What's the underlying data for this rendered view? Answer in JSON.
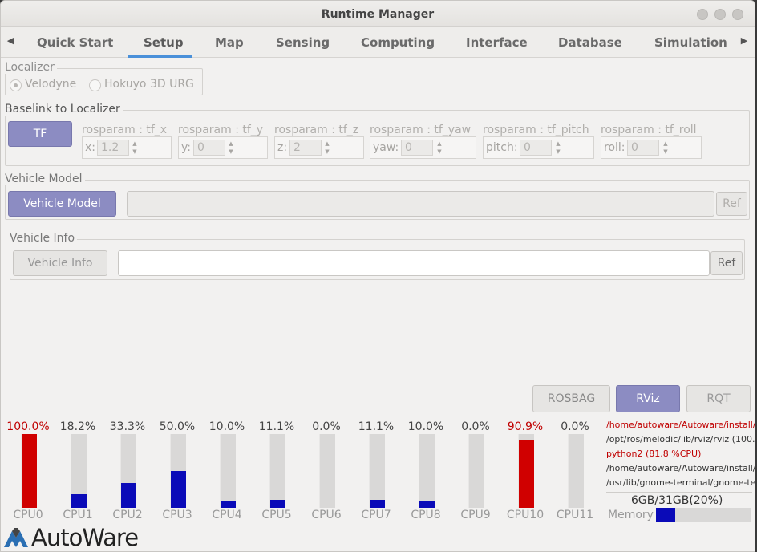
{
  "window": {
    "title": "Runtime Manager"
  },
  "tabs": [
    {
      "label": "Quick Start"
    },
    {
      "label": "Setup"
    },
    {
      "label": "Map"
    },
    {
      "label": "Sensing"
    },
    {
      "label": "Computing"
    },
    {
      "label": "Interface"
    },
    {
      "label": "Database"
    },
    {
      "label": "Simulation"
    }
  ],
  "localizer": {
    "label": "Localizer",
    "options": [
      {
        "label": "Velodyne",
        "checked": true
      },
      {
        "label": "Hokuyo 3D URG",
        "checked": false
      }
    ]
  },
  "baselink": {
    "label": "Baselink to Localizer",
    "tf_button": "TF",
    "params": [
      {
        "label": "rosparam : tf_x",
        "prefix": "x:",
        "value": "1.2"
      },
      {
        "label": "rosparam : tf_y",
        "prefix": "y:",
        "value": "0"
      },
      {
        "label": "rosparam : tf_z",
        "prefix": "z:",
        "value": "2"
      },
      {
        "label": "rosparam : tf_yaw",
        "prefix": "yaw:",
        "value": "0"
      },
      {
        "label": "rosparam : tf_pitch",
        "prefix": "pitch:",
        "value": "0"
      },
      {
        "label": "rosparam : tf_roll",
        "prefix": "roll:",
        "value": "0"
      }
    ]
  },
  "vehicle_model": {
    "label": "Vehicle Model",
    "button": "Vehicle Model",
    "path_value": "",
    "ref_button": "Ref"
  },
  "vehicle_info": {
    "label": "Vehicle Info",
    "button": "Vehicle Info",
    "path_value": "",
    "ref_button": "Ref"
  },
  "actions": {
    "rosbag": "ROSBAG",
    "rviz": "RViz",
    "rqt": "RQT"
  },
  "cpus": [
    {
      "name": "CPU0",
      "percent": "100.0%",
      "value": 100.0,
      "hot": true
    },
    {
      "name": "CPU1",
      "percent": "18.2%",
      "value": 18.2,
      "hot": false
    },
    {
      "name": "CPU2",
      "percent": "33.3%",
      "value": 33.3,
      "hot": false
    },
    {
      "name": "CPU3",
      "percent": "50.0%",
      "value": 50.0,
      "hot": false
    },
    {
      "name": "CPU4",
      "percent": "10.0%",
      "value": 10.0,
      "hot": false
    },
    {
      "name": "CPU5",
      "percent": "11.1%",
      "value": 11.1,
      "hot": false
    },
    {
      "name": "CPU6",
      "percent": "0.0%",
      "value": 0.0,
      "hot": false
    },
    {
      "name": "CPU7",
      "percent": "11.1%",
      "value": 11.1,
      "hot": false
    },
    {
      "name": "CPU8",
      "percent": "10.0%",
      "value": 10.0,
      "hot": false
    },
    {
      "name": "CPU9",
      "percent": "0.0%",
      "value": 0.0,
      "hot": false
    },
    {
      "name": "CPU10",
      "percent": "90.9%",
      "value": 90.9,
      "hot": true
    },
    {
      "name": "CPU11",
      "percent": "0.0%",
      "value": 0.0,
      "hot": false
    }
  ],
  "processes": [
    {
      "text": "/home/autoware/Autoware/install/",
      "hot": true
    },
    {
      "text": "/opt/ros/melodic/lib/rviz/rviz (100.",
      "hot": false
    },
    {
      "text": "python2 (81.8 %CPU)",
      "hot": true
    },
    {
      "text": "/home/autoware/Autoware/install/",
      "hot": false
    },
    {
      "text": "/usr/lib/gnome-terminal/gnome-te",
      "hot": false
    }
  ],
  "memory": {
    "text": "6GB/31GB(20%)",
    "label": "Memory",
    "fraction": 0.2
  },
  "brand": {
    "logo_text": "AutoWare"
  },
  "colors": {
    "accent": "#4a90d9",
    "primary_button": "#8c8cc2",
    "cpu_hot": "#d00000",
    "cpu_normal": "#0a0ab8"
  }
}
